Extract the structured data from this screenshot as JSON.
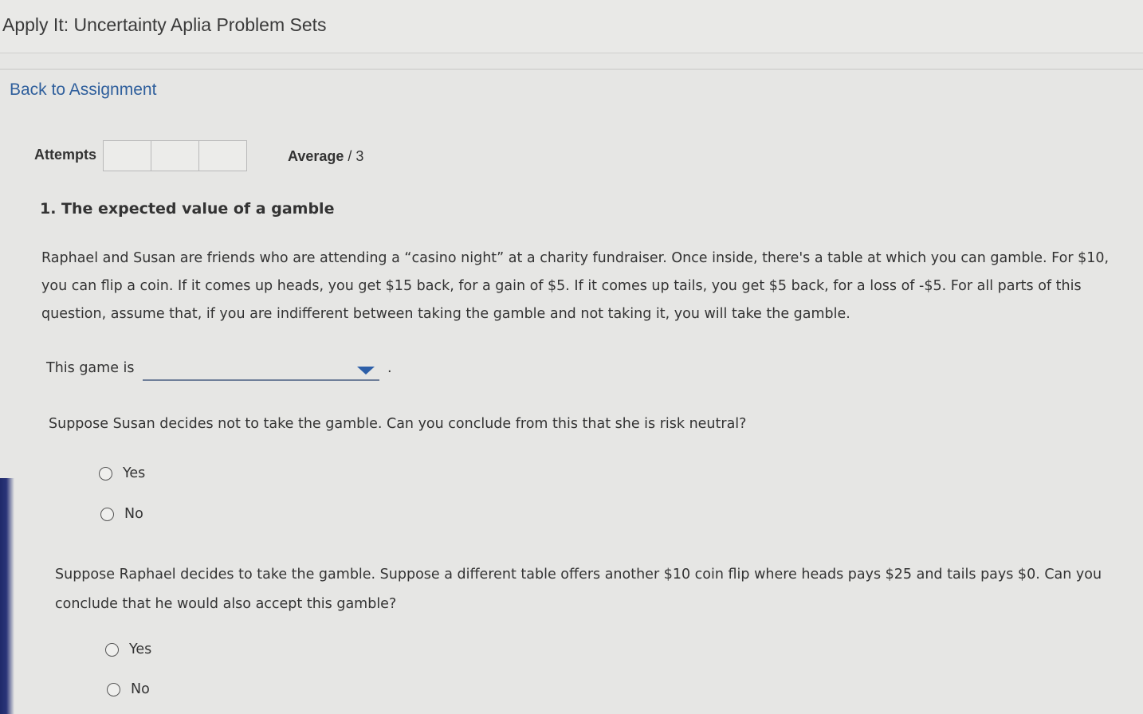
{
  "header": {
    "title": "Apply It: Uncertainty Aplia Problem Sets"
  },
  "nav": {
    "back_link": "Back to Assignment"
  },
  "attempts": {
    "label": "Attempts",
    "box_count": 3
  },
  "average": {
    "label": "Average",
    "suffix": "/ 3"
  },
  "question": {
    "heading": "1. The expected value of a gamble",
    "paragraph": "Raphael and Susan are friends who are attending a “casino night” at a charity fundraiser. Once inside, there's a table at which you can gamble. For $10, you can flip a coin. If it comes up heads, you get $15 back, for a gain of $5. If it comes up tails, you get $5 back, for a loss of -$5. For all parts of this question, assume that, if you are indifferent between taking the gamble and not taking it, you will take the gamble.",
    "dropdown_prefix": "This game is",
    "dropdown_value": "",
    "dropdown_suffix": ".",
    "part2": {
      "text": "Suppose Susan decides not to take the gamble. Can you conclude from this that she is risk neutral?",
      "options": [
        "Yes",
        "No"
      ]
    },
    "part3": {
      "text": "Suppose Raphael decides to take the gamble. Suppose a different table offers another $10 coin flip where heads pays $25 and tails pays $0. Can you conclude that he would also accept this gamble?",
      "options": [
        "Yes",
        "No"
      ]
    }
  },
  "colors": {
    "link": "#2f5f9c",
    "dropdown_caret": "#2d5fa8",
    "background": "#e6e6e4"
  }
}
